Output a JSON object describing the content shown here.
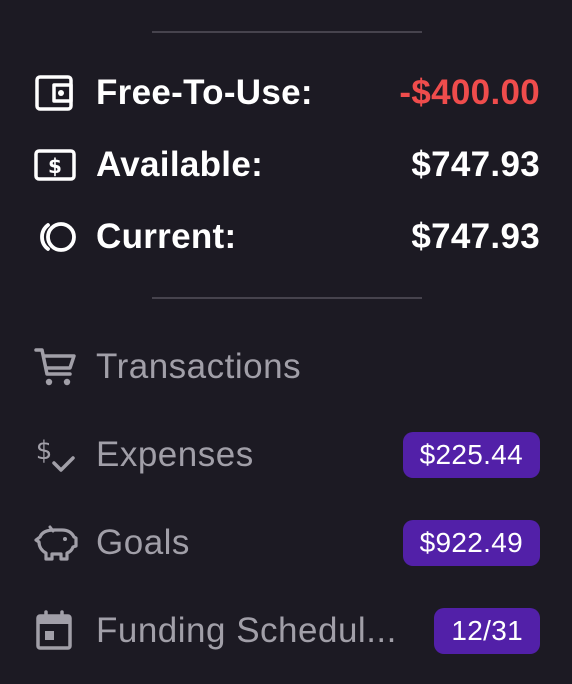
{
  "balances": [
    {
      "icon": "wallet-icon",
      "label": "Free-To-Use:",
      "value": "-$400.00",
      "negative": true
    },
    {
      "icon": "dollar-bill-icon",
      "label": "Available:",
      "value": "$747.93",
      "negative": false
    },
    {
      "icon": "coins-icon",
      "label": "Current:",
      "value": "$747.93",
      "negative": false
    }
  ],
  "nav": [
    {
      "icon": "cart-icon",
      "label": "Transactions",
      "badge": ""
    },
    {
      "icon": "dollar-check-icon",
      "label": "Expenses",
      "badge": "$225.44"
    },
    {
      "icon": "piggy-bank-icon",
      "label": "Goals",
      "badge": "$922.49"
    },
    {
      "icon": "calendar-icon",
      "label": "Funding Schedul...",
      "badge": "12/31"
    }
  ],
  "colors": {
    "background": "#1c1a23",
    "negative": "#ef4c4c",
    "badge": "#5220a8",
    "nav_text": "#a19fa8"
  }
}
